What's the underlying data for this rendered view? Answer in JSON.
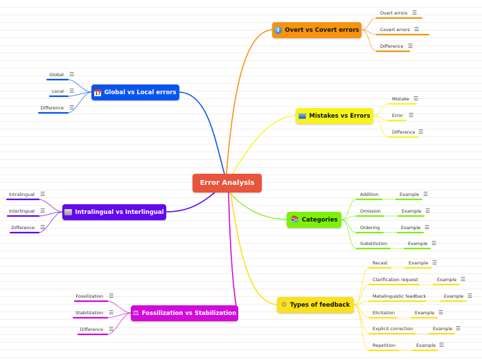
{
  "root": {
    "label": "Error Analysis",
    "color": "#e8543c"
  },
  "menu_glyph": "☰",
  "branches": [
    {
      "id": "overt",
      "label": "Overt vs Covert errors",
      "icon": "info-icon",
      "color": "#f7930f",
      "text_color": "#111111",
      "children": [
        {
          "label": "Overt errors"
        },
        {
          "label": "Covert errors"
        },
        {
          "label": "Difference"
        }
      ]
    },
    {
      "id": "mistakes",
      "label": "Mistakes vs Errors",
      "icon": "monitor-icon",
      "color": "#f5f51a",
      "text_color": "#111111",
      "children": [
        {
          "label": "Mistake"
        },
        {
          "label": "Error"
        },
        {
          "label": "Difference"
        }
      ]
    },
    {
      "id": "global",
      "label": "Global vs Local errors",
      "icon": "calendar-icon",
      "color": "#0b55ee",
      "text_color": "#ffffff",
      "calendar_day": "17",
      "children": [
        {
          "label": "Global"
        },
        {
          "label": "Local"
        },
        {
          "label": "Difference"
        }
      ]
    },
    {
      "id": "intra",
      "label": "Intralingual vs Interlingual",
      "icon": "folder-icon",
      "color": "#6209ee",
      "text_color": "#ffffff",
      "children": [
        {
          "label": "Intralingual"
        },
        {
          "label": "Interlingual"
        },
        {
          "label": "Difference"
        }
      ]
    },
    {
      "id": "categories",
      "label": "Categories",
      "icon": "books-icon",
      "color": "#7cf20a",
      "text_color": "#111111",
      "children": [
        {
          "label": "Addition",
          "example": "Example"
        },
        {
          "label": "Omission",
          "example": "Example"
        },
        {
          "label": "Ordering",
          "example": "Example"
        },
        {
          "label": "Substitution",
          "example": "Example"
        }
      ]
    },
    {
      "id": "feedback",
      "label": "Types of feedback",
      "icon": "gear-icon",
      "color": "#fbe11a",
      "text_color": "#111111",
      "children": [
        {
          "label": "Recast",
          "example": "Example"
        },
        {
          "label": "Clarification request",
          "example": "Example"
        },
        {
          "label": "Metalinguistic feedback",
          "example": "Example"
        },
        {
          "label": "Elicitation",
          "example": "Example"
        },
        {
          "label": "Explicit correction",
          "example": "Example"
        },
        {
          "label": "Repetition",
          "example": "Example"
        }
      ]
    },
    {
      "id": "fossil",
      "label": "Fossilization vs Stabilization",
      "icon": "scales-icon",
      "color": "#d20adb",
      "text_color": "#ffffff",
      "children": [
        {
          "label": "Fossilization"
        },
        {
          "label": "Stabilization"
        },
        {
          "label": "Difference"
        }
      ]
    }
  ]
}
